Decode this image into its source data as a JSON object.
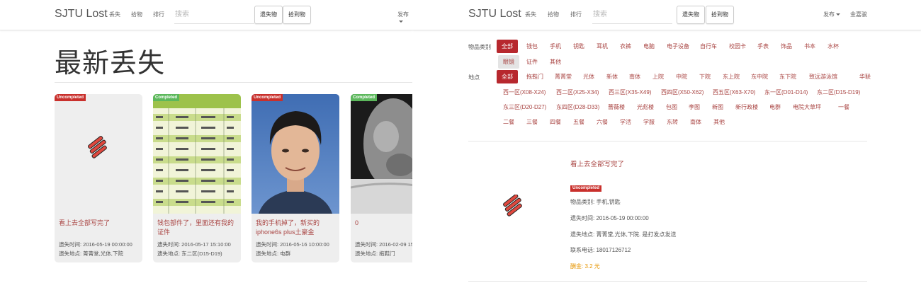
{
  "left": {
    "nav": {
      "brand": "SJTU Lost",
      "links": [
        "丢失",
        "拾物",
        "排行"
      ],
      "search_placeholder": "搜索",
      "btn_lost": "遗失物",
      "btn_found": "拾到物",
      "publish": "发布"
    },
    "page_title": "最新丢失",
    "cards": [
      {
        "status": "Uncompleted",
        "title": "看上去全部写完了",
        "time": "遗失时间: 2016-05-19 00:00:00",
        "place": "遗失地点: 菁菁堂,光体,下院"
      },
      {
        "status": "Completed",
        "title": "钱包部件了，里面还有我的证件",
        "time": "遗失时间: 2016-05-17 15:10:00",
        "place": "遗失地点: 东二区(D15-D19)"
      },
      {
        "status": "Uncompleted",
        "title": "我的手机掉了，新买的iphone6s plus土豪金",
        "time": "遗失时间: 2016-05-16 10:00:00",
        "place": "遗失地点: 电群"
      },
      {
        "status": "Completed",
        "title": "0",
        "time": "遗失时间: 2016-02-09 15:",
        "place": "遗失地点: 拖鞋门"
      }
    ]
  },
  "right": {
    "nav": {
      "brand": "SJTU Lost",
      "links": [
        "丢失",
        "拾物",
        "排行"
      ],
      "search_placeholder": "搜索",
      "btn_lost": "遗失物",
      "btn_found": "拾到物",
      "publish": "发布",
      "user": "金嘉骏"
    },
    "filters": {
      "category_label": "物品类别",
      "categories": [
        "全部",
        "钱包",
        "手机",
        "钥匙",
        "耳机",
        "衣裤",
        "电脑",
        "电子设备",
        "自行车",
        "校园卡",
        "手表",
        "饰品",
        "书本",
        "水杯",
        "眼镜",
        "证件",
        "其他"
      ],
      "place_label": "地点",
      "places": [
        "全部",
        "拖鞋门",
        "菁菁堂",
        "光体",
        "新体",
        "南体",
        "上院",
        "中院",
        "下院",
        "东上院",
        "东中院",
        "东下院",
        "致远游泳馆",
        "华联",
        "西一区(X08-X24)",
        "西二区(X25-X34)",
        "西三区(X35-X49)",
        "西四区(X50-X62)",
        "西五区(X63-X70)",
        "东一区(D01-D14)",
        "东二区(D15-D19)",
        "东三区(D20-D27)",
        "东四区(D28-D33)",
        "蔷薇楼",
        "光彪楼",
        "包图",
        "李图",
        "新图",
        "新行政楼",
        "电群",
        "电院大草坪",
        "一餐",
        "二餐",
        "三餐",
        "四餐",
        "五餐",
        "六餐",
        "学活",
        "学服",
        "东转",
        "南体",
        "其他"
      ]
    },
    "detail": {
      "title": "看上去全部写完了",
      "status": "Uncompleted",
      "category": "物品类别: 手机,钥匙",
      "time": "遗失时间: 2016-05-19 00:00:00",
      "place": "遗失地点: 菁菁堂,光体,下院. 是打发点发送",
      "phone": "联系电话: 18017126712",
      "reward": "酬金: 3.2 元"
    }
  },
  "colors": {
    "accent": "#b7282e",
    "link_red": "#a94442",
    "badge_red": "#c9302c",
    "badge_green": "#5cb85c",
    "reward": "#e69500"
  }
}
